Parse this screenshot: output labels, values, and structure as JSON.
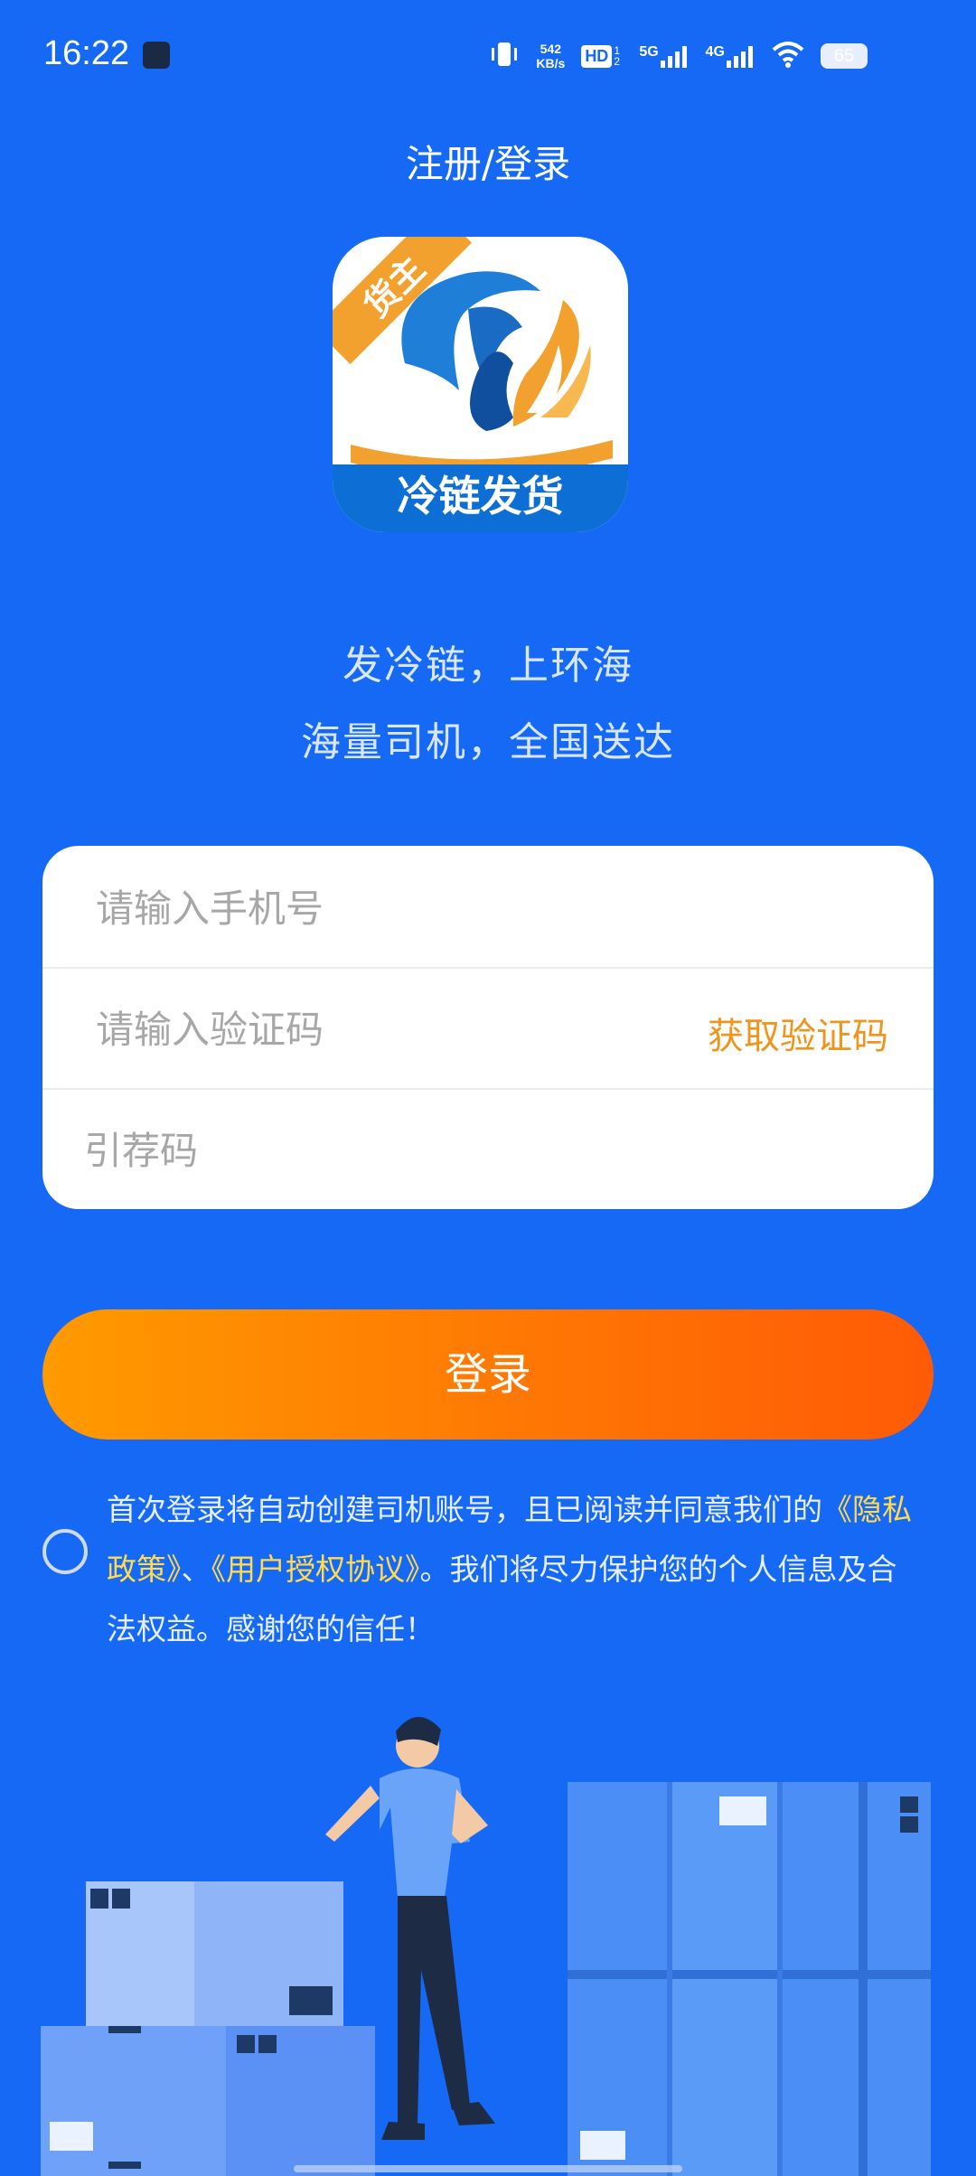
{
  "status_bar": {
    "time": "16:22",
    "net_speed_value": "542",
    "net_speed_unit": "KB/s",
    "hd_label": "HD",
    "hd_sub": "1 2",
    "sig1_label": "5G",
    "sig2_label": "4G",
    "battery": "65"
  },
  "header": {
    "title": "注册/登录"
  },
  "logo": {
    "ribbon_text": "货主",
    "bottom_text": "冷链发货"
  },
  "slogan": {
    "line1": "发冷链，上环海",
    "line2": "海量司机，全国送达"
  },
  "form": {
    "phone": {
      "placeholder": "请输入手机号",
      "value": ""
    },
    "code": {
      "placeholder": "请输入验证码",
      "value": "",
      "get_code_label": "获取验证码"
    },
    "referral": {
      "placeholder": "引荐码",
      "value": ""
    }
  },
  "login_button": {
    "label": "登录"
  },
  "agreement": {
    "prefix": "首次登录将自动创建司机账号，且已阅读并同意我们的",
    "link1": "《隐私政策》",
    "sep": "、",
    "link2": "《用户授权协议》",
    "suffix": "。我们将尽力保护您的个人信息及合法权益。感谢您的信任！"
  },
  "colors": {
    "background": "#1669f4",
    "accent_orange": "#f0941c",
    "button_start": "#ff9a00",
    "button_end": "#ff5a06",
    "link_yellow": "#ffdb4d"
  },
  "icons": [
    "vibrate-icon",
    "hd-icon",
    "signal-icon",
    "wifi-icon",
    "battery-icon",
    "app-notification-icon"
  ]
}
